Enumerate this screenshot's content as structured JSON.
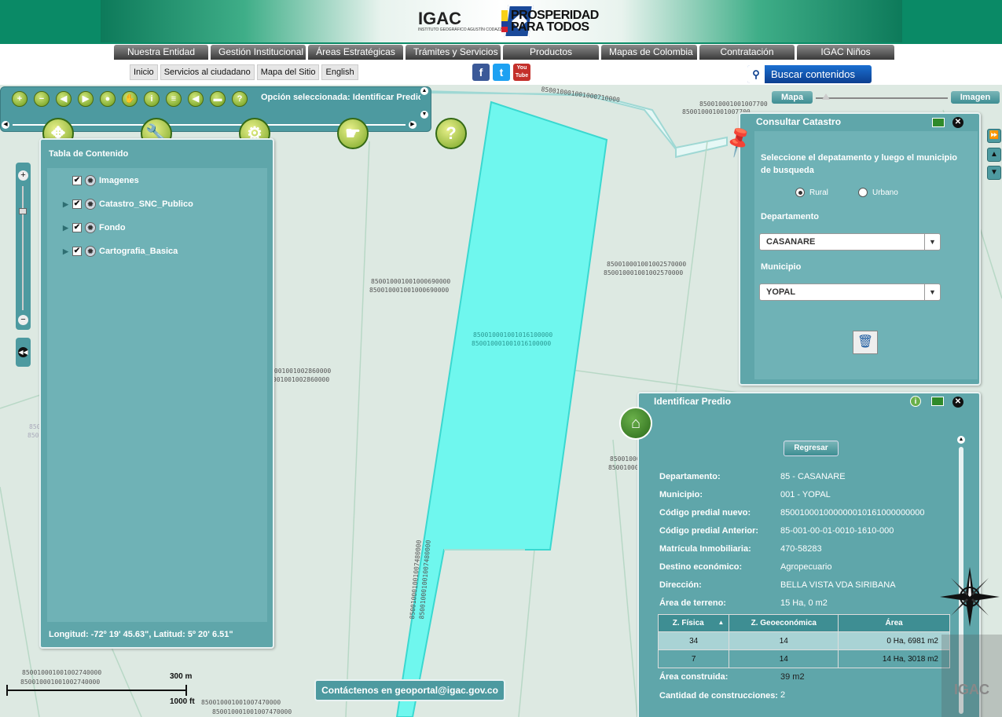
{
  "header": {
    "igac_name": "IGAC",
    "igac_subtitle": "INSTITUTO GEOGRÁFICO AGUSTÍN CODAZZI",
    "campaign_line1": "PROSPERIDAD",
    "campaign_line2": "PARA TODOS"
  },
  "nav": {
    "items": [
      "Nuestra Entidad",
      "Gestión Institucional",
      "Áreas Estratégicas",
      "Trámites y Servicios",
      "Productos",
      "Mapas de Colombia",
      "Contratación",
      "IGAC Niños"
    ]
  },
  "subnav": {
    "items": [
      "Inicio",
      "Servicios al ciudadano",
      "Mapa del Sitio",
      "English"
    ]
  },
  "social": {
    "facebook": "f",
    "twitter": "t",
    "youtube": "You Tube"
  },
  "search": {
    "label": "Buscar contenidos",
    "icon": "search-icon"
  },
  "toolbar": {
    "option_label": "Opción seleccionada: Identificar Predio"
  },
  "map_toggle": {
    "map": "Mapa",
    "image": "Imagen"
  },
  "toc": {
    "title": "Tabla de Contenido",
    "layers": [
      {
        "name": "Imagenes",
        "checked": true,
        "expandable": false
      },
      {
        "name": "Catastro_SNC_Publico",
        "checked": true,
        "expandable": true
      },
      {
        "name": "Fondo",
        "checked": true,
        "expandable": true
      },
      {
        "name": "Cartografia_Basica",
        "checked": true,
        "expandable": true
      }
    ],
    "coords": "Longitud: -72º 19' 45.63\", Latitud: 5º 20' 6.51\""
  },
  "catastro": {
    "title": "Consultar Catastro",
    "instruction": "Seleccione el depatamento y luego el municipio de busqueda",
    "radio_rural": "Rural",
    "radio_urbano": "Urbano",
    "selected": "Rural",
    "dept_label": "Departamento",
    "dept_value": "CASANARE",
    "mun_label": "Municipio",
    "mun_value": "YOPAL"
  },
  "identificar": {
    "title": "Identificar Predio",
    "back": "Regresar",
    "fields": [
      {
        "k": "Departamento:",
        "v": "85 - CASANARE"
      },
      {
        "k": "Municipio:",
        "v": "001 - YOPAL"
      },
      {
        "k": "Código predial nuevo:",
        "v": "850010001000000010161000000000"
      },
      {
        "k": "Código predial Anterior:",
        "v": "85-001-00-01-0010-1610-000"
      },
      {
        "k": "Matrícula Inmobiliaria:",
        "v": "470-58283"
      },
      {
        "k": "Destino económico:",
        "v": "Agropecuario"
      },
      {
        "k": "Dirección:",
        "v": "BELLA VISTA VDA SIRIBANA"
      },
      {
        "k": "Área de terreno:",
        "v": "15 Ha, 0 m2"
      }
    ],
    "table_headers": [
      "Z. Física",
      "Z. Geoeconómica",
      "Área"
    ],
    "table_rows": [
      [
        "34",
        "14",
        "0 Ha, 6981 m2"
      ],
      [
        "7",
        "14",
        "14 Ha, 3018 m2"
      ]
    ],
    "built_label": "Área construida:",
    "built_value": "39 m2",
    "count_label": "Cantidad de construcciones:",
    "count_value": "2"
  },
  "contact": "Contáctenos en geoportal@igac.gov.co",
  "scale": {
    "meters": "300 m",
    "feet": "1000 ft"
  },
  "parcels": [
    "850010001001000710000",
    "850010001001007700",
    "850010001001007700",
    "850010001001002570000",
    "850010001001002570000",
    "850010001001000690000",
    "850010001001000690000",
    "850010001001016100000",
    "850010001001016100000",
    "850010001001002720000",
    "850010001001002720000",
    "850010001001002860000",
    "850010001001002860000",
    "850010001001002710000",
    "850010001001002710000",
    "850010001001002640000",
    "850010001001002640000",
    "850010001001002530000",
    "850010001001002530000",
    "850010001001002740000",
    "850010001001002740000",
    "850010001001007470000",
    "850010001001007470000",
    "850010001001007480000",
    "850010001001007480000",
    "850010001001002700000",
    "850010001001001710000",
    "850010001001001710000",
    "850010001001001880000"
  ],
  "watermark": "IGAC",
  "colors": {
    "panel": "#5fa6aa",
    "selected_parcel": "#6ff7ee",
    "header_green": "#0a8a66"
  }
}
